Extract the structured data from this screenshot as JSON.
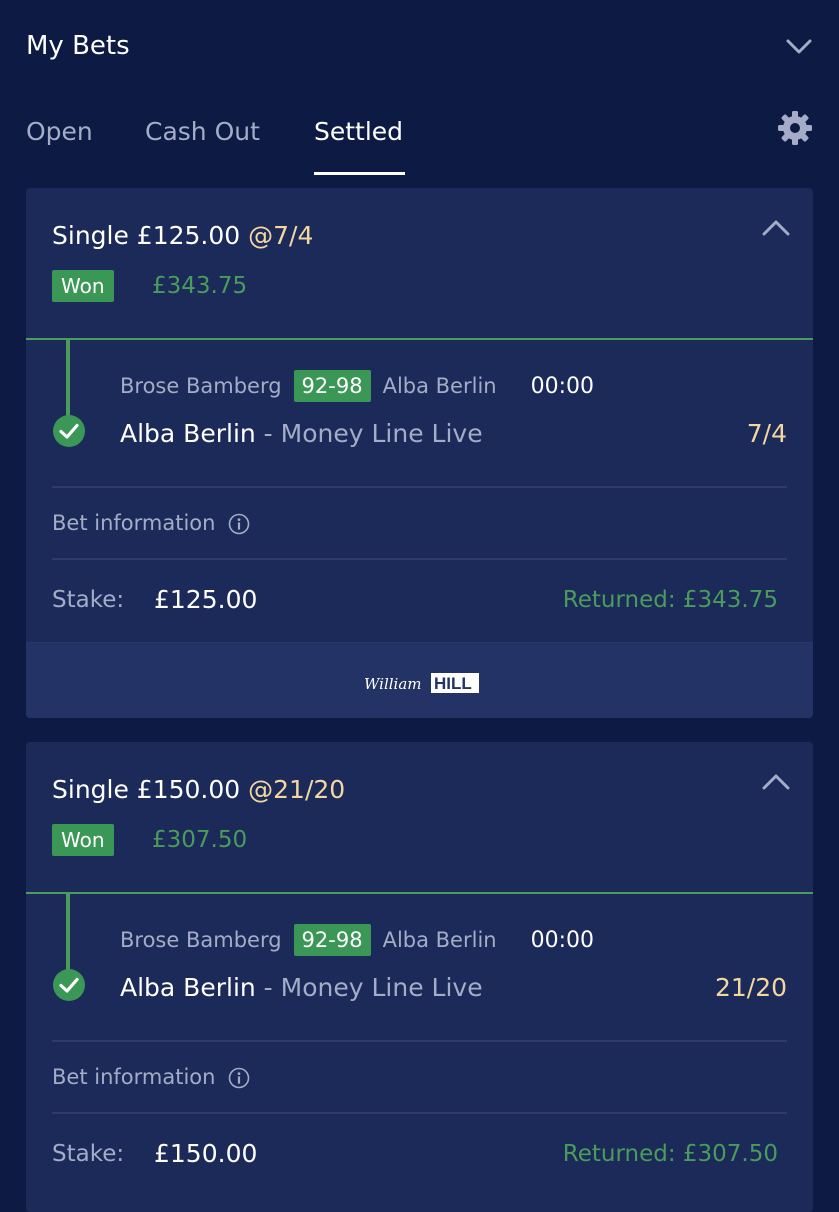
{
  "header": {
    "title": "My Bets"
  },
  "tabs": [
    {
      "label": "Open"
    },
    {
      "label": "Cash Out"
    },
    {
      "label": "Settled"
    }
  ],
  "colors": {
    "background": "#0c1a44",
    "card": "#1b2a58",
    "accent_green": "#4a9b5c",
    "odds_gold": "#f2d8a0",
    "muted_text": "#a4acc8"
  },
  "bets": [
    {
      "type_stake": "Single £125.00",
      "odds": "@7/4",
      "status": "Won",
      "payout": "£343.75",
      "event": {
        "home": "Brose Bamberg",
        "score": "92-98",
        "away": "Alba Berlin",
        "clock": "00:00"
      },
      "selection": "Alba Berlin",
      "market": " - Money Line Live",
      "selection_odds": "7/4",
      "bet_info_label": "Bet information",
      "stake_label": "Stake:",
      "stake": "£125.00",
      "returned": "Returned: £343.75",
      "brand": "William HILL"
    },
    {
      "type_stake": "Single £150.00",
      "odds": "@21/20",
      "status": "Won",
      "payout": "£307.50",
      "event": {
        "home": "Brose Bamberg",
        "score": "92-98",
        "away": "Alba Berlin",
        "clock": "00:00"
      },
      "selection": "Alba Berlin",
      "market": " - Money Line Live",
      "selection_odds": "21/20",
      "bet_info_label": "Bet information",
      "stake_label": "Stake:",
      "stake": "£150.00",
      "returned": "Returned: £307.50"
    }
  ],
  "icons": {
    "collapse": "chevron-down-icon",
    "settings": "gear-icon",
    "expand": "chevron-up-icon",
    "selection_status": "check-circle-icon",
    "info": "info-circle-icon"
  }
}
